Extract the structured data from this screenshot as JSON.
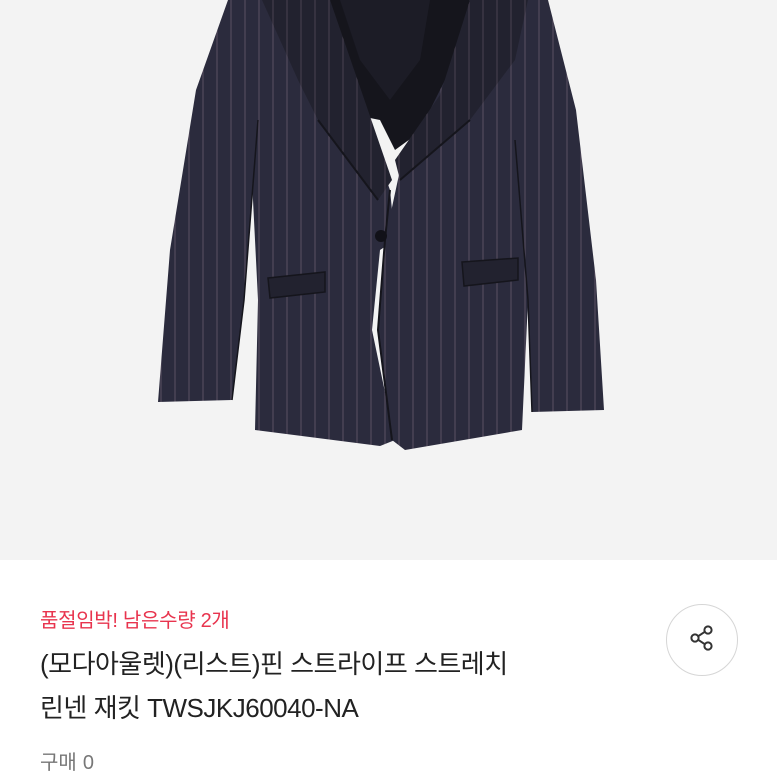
{
  "product": {
    "image_alt": "pinstripe jacket",
    "stock_alert": "품절임박! 남은수량 2개",
    "title_line1": "(모다아울렛)(리스트)핀 스트라이프 스트레치",
    "title_line2": "린넨 재킷 TWSJKJ60040-NA",
    "purchase_label": "구매",
    "purchase_count": "0"
  },
  "icons": {
    "share": "share-icon"
  },
  "colors": {
    "alert": "#e8344e",
    "jacket": "#2b2b3d",
    "image_bg": "#f3f3f3"
  }
}
